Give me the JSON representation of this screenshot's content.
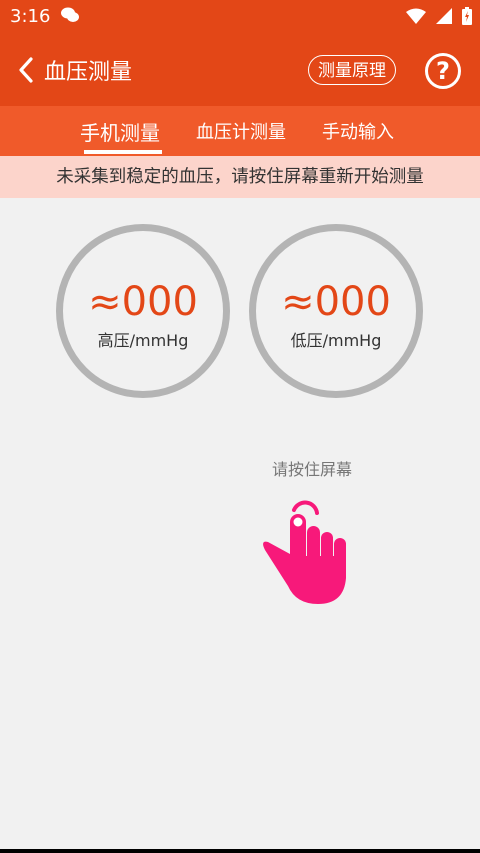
{
  "status": {
    "time": "3:16"
  },
  "appbar": {
    "title": "血压测量",
    "principle_label": "测量原理",
    "help_label": "?"
  },
  "tabs": [
    {
      "label": "手机测量",
      "active": true
    },
    {
      "label": "血压计测量",
      "active": false
    },
    {
      "label": "手动输入",
      "active": false
    }
  ],
  "notice": "未采集到稳定的血压，请按住屏幕重新开始测量",
  "gauges": {
    "high": {
      "value": "≈000",
      "label": "高压/mmHg"
    },
    "low": {
      "value": "≈000",
      "label": "低压/mmHg"
    }
  },
  "hint": "请按住屏幕",
  "colors": {
    "primary": "#e34717",
    "tab_bar": "#f05a2a",
    "notice_bg": "#fcd4cb",
    "hand": "#f7197a",
    "ring": "#b4b4b4"
  },
  "icons": [
    "wechat-notif-icon",
    "wifi-icon",
    "signal-icon",
    "battery-icon",
    "back-arrow-icon",
    "help-icon",
    "touch-hand-icon"
  ]
}
